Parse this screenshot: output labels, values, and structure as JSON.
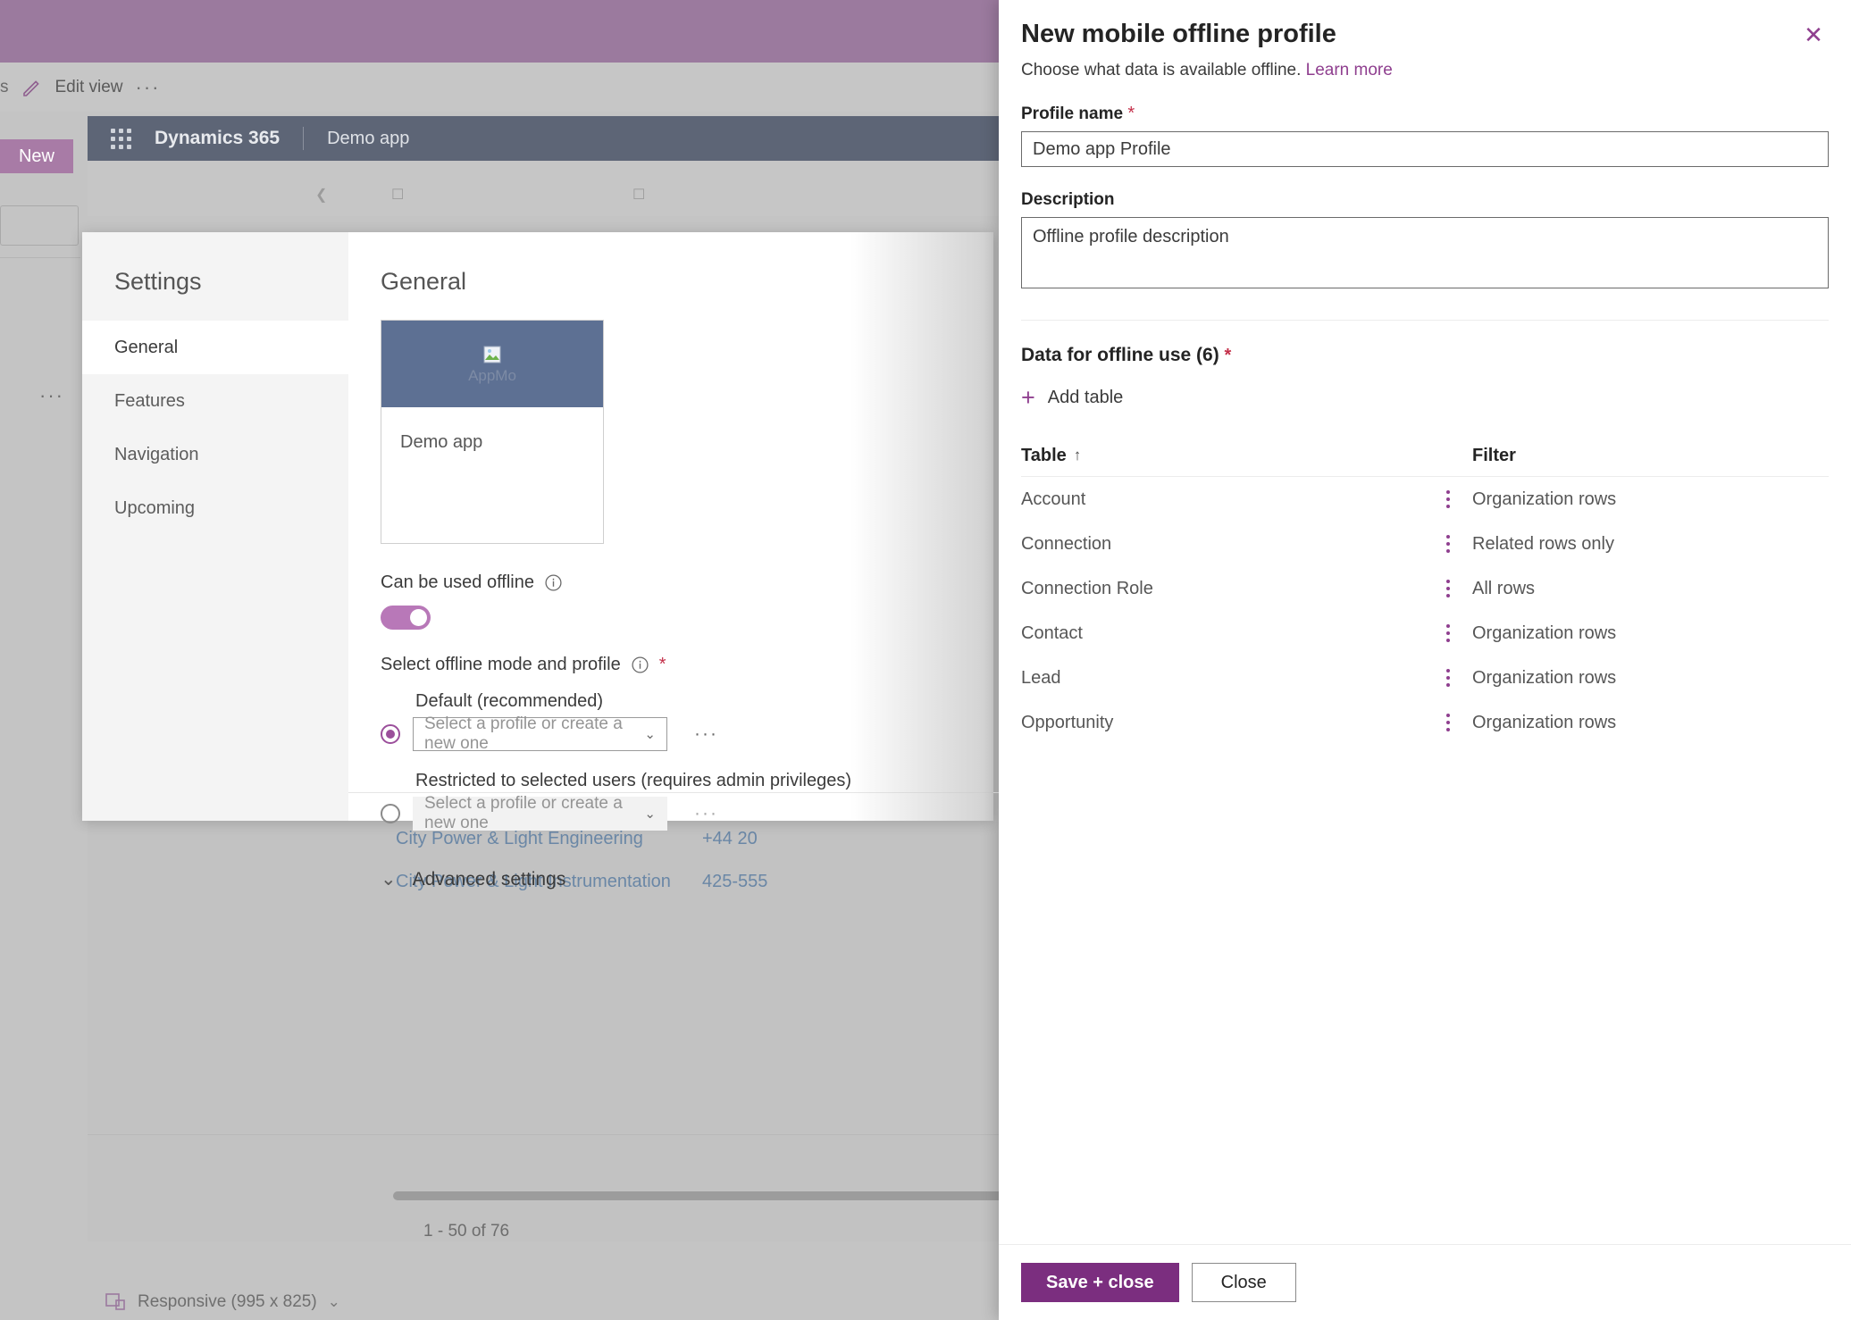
{
  "background": {
    "toolbar": {
      "left_text": "s",
      "edit_view_label": "Edit view",
      "overflow_label": "···"
    },
    "new_button_label": "New",
    "left_overflow_label": "···",
    "app_bar": {
      "product_name": "Dynamics 365",
      "app_name": "Demo app"
    },
    "list": {
      "rows": [
        {
          "name": "City Power & Light Engineering",
          "phone": "+44 20"
        },
        {
          "name": "City Power & Light Instrumentation",
          "phone": "425-555"
        }
      ],
      "record_count": "1 - 50 of 76"
    },
    "status_bar": {
      "label": "Responsive (995 x 825)",
      "chevron": "⌄"
    }
  },
  "settings_modal": {
    "nav_title": "Settings",
    "nav_items": [
      {
        "label": "General",
        "active": true
      },
      {
        "label": "Features",
        "active": false
      },
      {
        "label": "Navigation",
        "active": false
      },
      {
        "label": "Upcoming",
        "active": false
      }
    ],
    "main_title": "General",
    "app_card": {
      "image_alt": "AppMo",
      "name": "Demo app"
    },
    "offline": {
      "can_be_used_label": "Can be used offline",
      "toggle_state": "on",
      "mode_label": "Select offline mode and profile",
      "required_marker": "*",
      "default_option_label": "Default (recommended)",
      "default_combo_placeholder": "Select a profile or create a new one",
      "restricted_option_label": "Restricted to selected users (requires admin privileges)",
      "restricted_combo_placeholder": "Select a profile or create a new one",
      "overflow_label": "···",
      "chevron": "⌄"
    },
    "advanced_settings_label": "Advanced settings",
    "advanced_chevron": "⌄"
  },
  "panel": {
    "title": "New mobile offline profile",
    "subtitle_text": "Choose what data is available offline.",
    "subtitle_link": "Learn more",
    "close_label": "✕",
    "profile_name": {
      "label": "Profile name",
      "required_marker": "*",
      "value": "Demo app Profile"
    },
    "description": {
      "label": "Description",
      "value": "Offline profile description"
    },
    "data_section": {
      "title": "Data for offline use (6)",
      "required_marker": "*",
      "add_table_label": "Add table",
      "add_table_icon": "+",
      "columns": {
        "table": "Table",
        "sort_indicator": "↑",
        "filter": "Filter"
      },
      "rows": [
        {
          "table": "Account",
          "filter": "Organization rows",
          "menu": "row-menu"
        },
        {
          "table": "Connection",
          "filter": "Related rows only",
          "menu": "row-menu"
        },
        {
          "table": "Connection Role",
          "filter": "All rows",
          "menu": "row-menu"
        },
        {
          "table": "Contact",
          "filter": "Organization rows",
          "menu": "row-menu"
        },
        {
          "table": "Lead",
          "filter": "Organization rows",
          "menu": "row-menu"
        },
        {
          "table": "Opportunity",
          "filter": "Organization rows",
          "menu": "row-menu"
        }
      ]
    },
    "footer": {
      "save_label": "Save + close",
      "close_label": "Close"
    }
  },
  "colors": {
    "accent_purple": "#7b2e7f",
    "link_purple": "#8f3f8f",
    "required_red": "#c4304a",
    "toggle_on": "#b878b8",
    "app_bar_bg": "#5d6576",
    "app_tile_bg": "#5d7093",
    "band_purple": "#9b7a9e"
  }
}
